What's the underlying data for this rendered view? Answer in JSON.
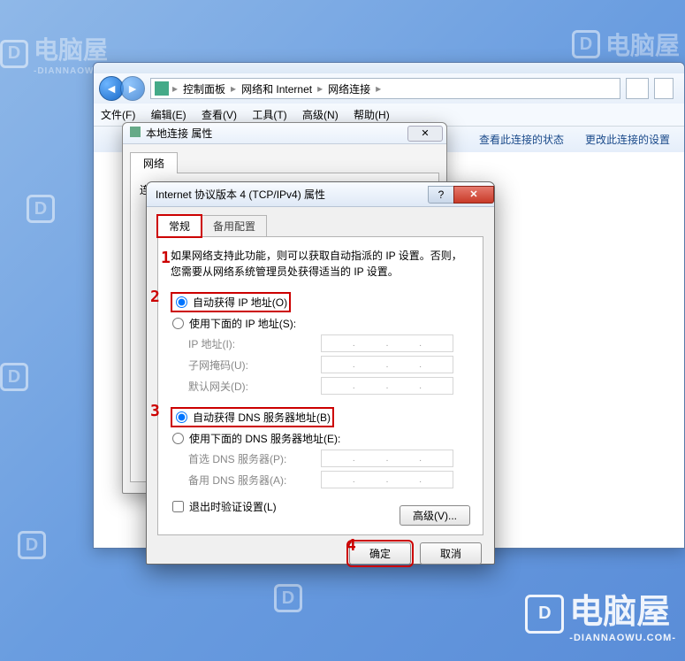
{
  "explorer": {
    "breadcrumb": {
      "root": "控制面板",
      "mid": "网络和 Internet",
      "leaf": "网络连接"
    },
    "menu": {
      "file": "文件(F)",
      "edit": "编辑(E)",
      "view": "查看(V)",
      "tools": "工具(T)",
      "advanced": "高级(N)",
      "help": "帮助(H)"
    },
    "toolbar": {
      "view_status": "查看此连接的状态",
      "change_settings": "更改此连接的设置"
    }
  },
  "props_dialog": {
    "title": "本地连接 属性",
    "tab_network": "网络",
    "section_label": "连接时使用："
  },
  "ipv4_dialog": {
    "title": "Internet 协议版本 4 (TCP/IPv4) 属性",
    "tabs": {
      "general": "常规",
      "alternate": "备用配置"
    },
    "description": "如果网络支持此功能，则可以获取自动指派的 IP 设置。否则，您需要从网络系统管理员处获得适当的 IP 设置。",
    "ip_section": {
      "auto_ip": "自动获得 IP 地址(O)",
      "manual_ip": "使用下面的 IP 地址(S):",
      "ip_label": "IP 地址(I):",
      "subnet_label": "子网掩码(U):",
      "gateway_label": "默认网关(D):"
    },
    "dns_section": {
      "auto_dns": "自动获得 DNS 服务器地址(B)",
      "manual_dns": "使用下面的 DNS 服务器地址(E):",
      "preferred_label": "首选 DNS 服务器(P):",
      "alternate_label": "备用 DNS 服务器(A):"
    },
    "validate_checkbox": "退出时验证设置(L)",
    "advanced_button": "高级(V)...",
    "ok_button": "确定",
    "cancel_button": "取消"
  },
  "annotations": {
    "a1": "1",
    "a2": "2",
    "a3": "3",
    "a4": "4"
  },
  "watermarks": {
    "brand": "电脑屋",
    "sub": "-DIANNAOWU.COM-"
  }
}
